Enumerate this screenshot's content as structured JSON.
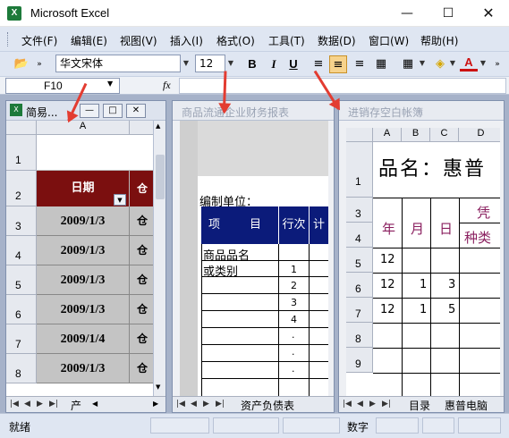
{
  "window": {
    "title": "Microsoft Excel",
    "app_icon": "X"
  },
  "menu": [
    "文件(F)",
    "编辑(E)",
    "视图(V)",
    "插入(I)",
    "格式(O)",
    "工具(T)",
    "数据(D)",
    "窗口(W)",
    "帮助(H)"
  ],
  "toolbar": {
    "font_name": "华文宋体",
    "font_size": "12",
    "bold": "B",
    "italic": "I",
    "underline": "U",
    "font_color_label": "A"
  },
  "formula": {
    "cell_ref": "F10",
    "fx": "fx",
    "content": ""
  },
  "window1": {
    "caption": "简易...",
    "col_a": "A",
    "header_date": "日期",
    "header_next": "仓",
    "rows": [
      "1",
      "2",
      "3",
      "4",
      "5",
      "6",
      "7",
      "8"
    ],
    "dates": [
      "2009/1/3",
      "2009/1/3",
      "2009/1/3",
      "2009/1/3",
      "2009/1/4",
      "2009/1/3"
    ],
    "next_col": [
      "仓",
      "仓",
      "仓",
      "仓",
      "仓",
      "仓"
    ],
    "tab": "产"
  },
  "window2": {
    "caption": "商品流通企业财务报表",
    "unit_label": "编制单位：",
    "col_item": "项        目",
    "col_line": "行次",
    "col_extra": "计",
    "item_rows": [
      "商品品名",
      "或类别"
    ],
    "line_nums": [
      "1",
      "2",
      "3",
      "4",
      ".",
      ".",
      "."
    ],
    "tab": "资产负债表"
  },
  "window3": {
    "caption": "进销存空白帐簿",
    "cols": [
      "A",
      "B",
      "C",
      "D"
    ],
    "rows": [
      "1",
      "3",
      "4",
      "5",
      "6",
      "7",
      "8",
      "9"
    ],
    "product_title": "品名：惠普",
    "hdr_year": "年",
    "hdr_month": "月",
    "hdr_day": "日",
    "hdr_voucher": "凭",
    "hdr_type": "种类",
    "data": [
      [
        "12",
        "",
        ""
      ],
      [
        "12",
        "1",
        "3"
      ],
      [
        "12",
        "1",
        "5"
      ]
    ],
    "tab_a": "目录",
    "tab_b": "惠普电脑"
  },
  "status": {
    "ready": "就绪",
    "num": "数字"
  },
  "colors": {
    "accent_header": "#7b0f0f",
    "blue_header": "#0b1b7a",
    "date_cell": "#c4c4c4",
    "arrow": "#e33c31"
  }
}
